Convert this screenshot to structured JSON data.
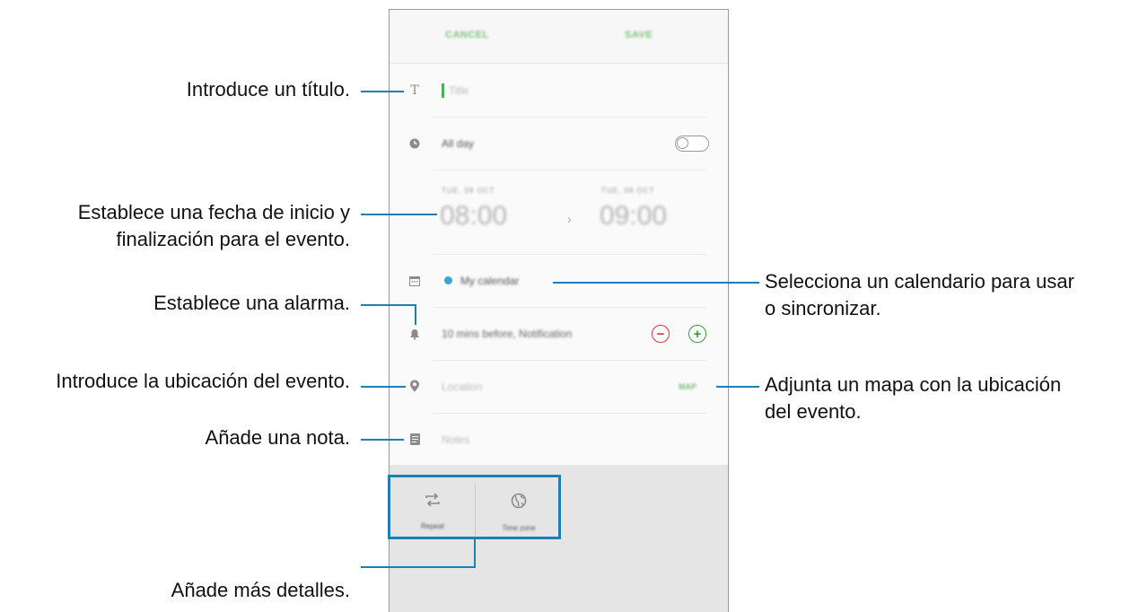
{
  "topbar": {
    "cancel_label": "CANCEL",
    "save_label": "SAVE"
  },
  "form": {
    "title_placeholder": "Title",
    "all_day_label": "All day",
    "all_day_on": false,
    "start_date": "TUE, 09 OCT",
    "start_time": "08:00",
    "end_date": "TUE, 09 OCT",
    "end_time": "09:00",
    "calendar_name": "My calendar",
    "calendar_color": "#3aa3d8",
    "reminder_label": "10 mins before, Notification",
    "location_placeholder": "Location",
    "map_label": "MAP",
    "notes_placeholder": "Notes"
  },
  "details": {
    "repeat_label": "Repeat",
    "timezone_label": "Time zone"
  },
  "callouts": {
    "title": "Introduce un título.",
    "dates_line1": "Establece una fecha de inicio y",
    "dates_line2": "finalización para el evento.",
    "alarm": "Establece una alarma.",
    "location": "Introduce la ubicación del evento.",
    "note": "Añade una nota.",
    "more_details": "Añade más detalles.",
    "calendar_line1": "Selecciona un calendario para usar",
    "calendar_line2": "o sincronizar.",
    "map_line1": "Adjunta un mapa con la ubicación",
    "map_line2": "del evento."
  },
  "colors": {
    "accent_line": "#1f7fb5",
    "action_green": "#7cc27e"
  }
}
